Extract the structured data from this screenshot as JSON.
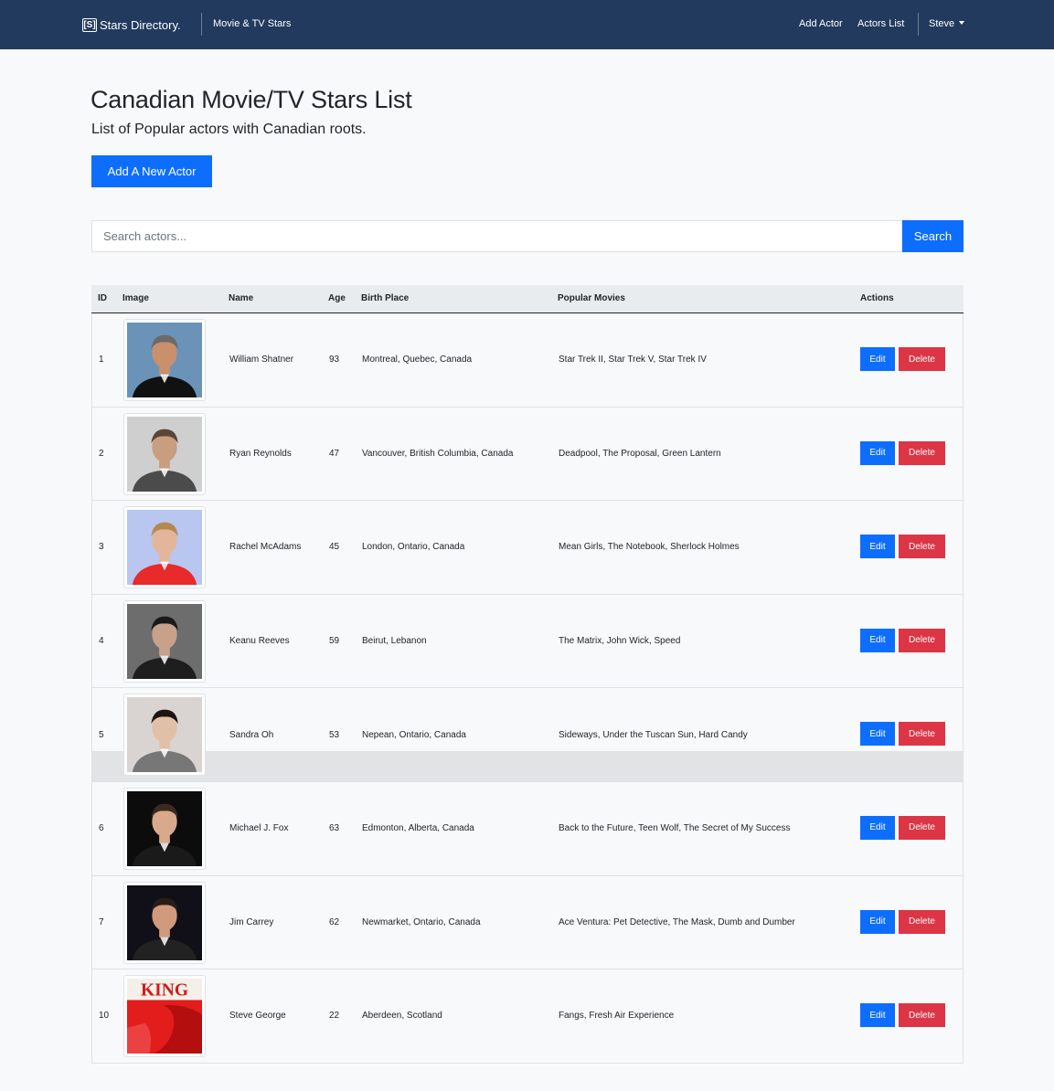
{
  "navbar": {
    "brand_logo": "[S]",
    "brand_text": "Stars Directory.",
    "section_link": "Movie & TV Stars",
    "add_actor": "Add Actor",
    "actors_list": "Actors List",
    "user": "Steve",
    "bg_color": "#223a5e"
  },
  "header": {
    "title": "Canadian Movie/TV Stars List",
    "subtitle": "List of Popular actors with Canadian roots.",
    "add_button": "Add A New Actor"
  },
  "search": {
    "placeholder": "Search actors...",
    "value": "",
    "button": "Search"
  },
  "table": {
    "columns": [
      "ID",
      "Image",
      "Name",
      "Age",
      "Birth Place",
      "Popular Movies",
      "Actions"
    ],
    "rows": [
      {
        "id": "1",
        "name": "William Shatner",
        "age": "93",
        "birth_place": "Montreal, Quebec, Canada",
        "movies": "Star Trek II, Star Trek V, Star Trek IV",
        "edit": "Edit",
        "delete": "Delete"
      },
      {
        "id": "2",
        "name": "Ryan Reynolds",
        "age": "47",
        "birth_place": "Vancouver, British Columbia, Canada",
        "movies": "Deadpool, The Proposal, Green Lantern",
        "edit": "Edit",
        "delete": "Delete"
      },
      {
        "id": "3",
        "name": "Rachel McAdams",
        "age": "45",
        "birth_place": "London, Ontario, Canada",
        "movies": "Mean Girls, The Notebook, Sherlock Holmes",
        "edit": "Edit",
        "delete": "Delete"
      },
      {
        "id": "4",
        "name": "Keanu Reeves",
        "age": "59",
        "birth_place": "Beirut, Lebanon",
        "movies": "The Matrix, John Wick, Speed",
        "edit": "Edit",
        "delete": "Delete"
      },
      {
        "id": "5",
        "name": "Sandra Oh",
        "age": "53",
        "birth_place": "Nepean, Ontario, Canada",
        "movies": "Sideways, Under the Tuscan Sun, Hard Candy",
        "edit": "Edit",
        "delete": "Delete"
      },
      {
        "id": "6",
        "name": "Michael J. Fox",
        "age": "63",
        "birth_place": "Edmonton, Alberta, Canada",
        "movies": "Back to the Future, Teen Wolf, The Secret of My Success",
        "edit": "Edit",
        "delete": "Delete"
      },
      {
        "id": "7",
        "name": "Jim Carrey",
        "age": "62",
        "birth_place": "Newmarket, Ontario, Canada",
        "movies": "Ace Ventura: Pet Detective, The Mask, Dumb and Dumber",
        "edit": "Edit",
        "delete": "Delete"
      },
      {
        "id": "10",
        "name": "Steve George",
        "age": "22",
        "birth_place": "Aberdeen, Scotland",
        "movies": "Fangs, Fresh Air Experience",
        "edit": "Edit",
        "delete": "Delete",
        "image_text": "KING"
      }
    ]
  },
  "colors": {
    "primary": "#0d6efd",
    "danger": "#dc3545",
    "page_bg": "#f8f9fa"
  }
}
